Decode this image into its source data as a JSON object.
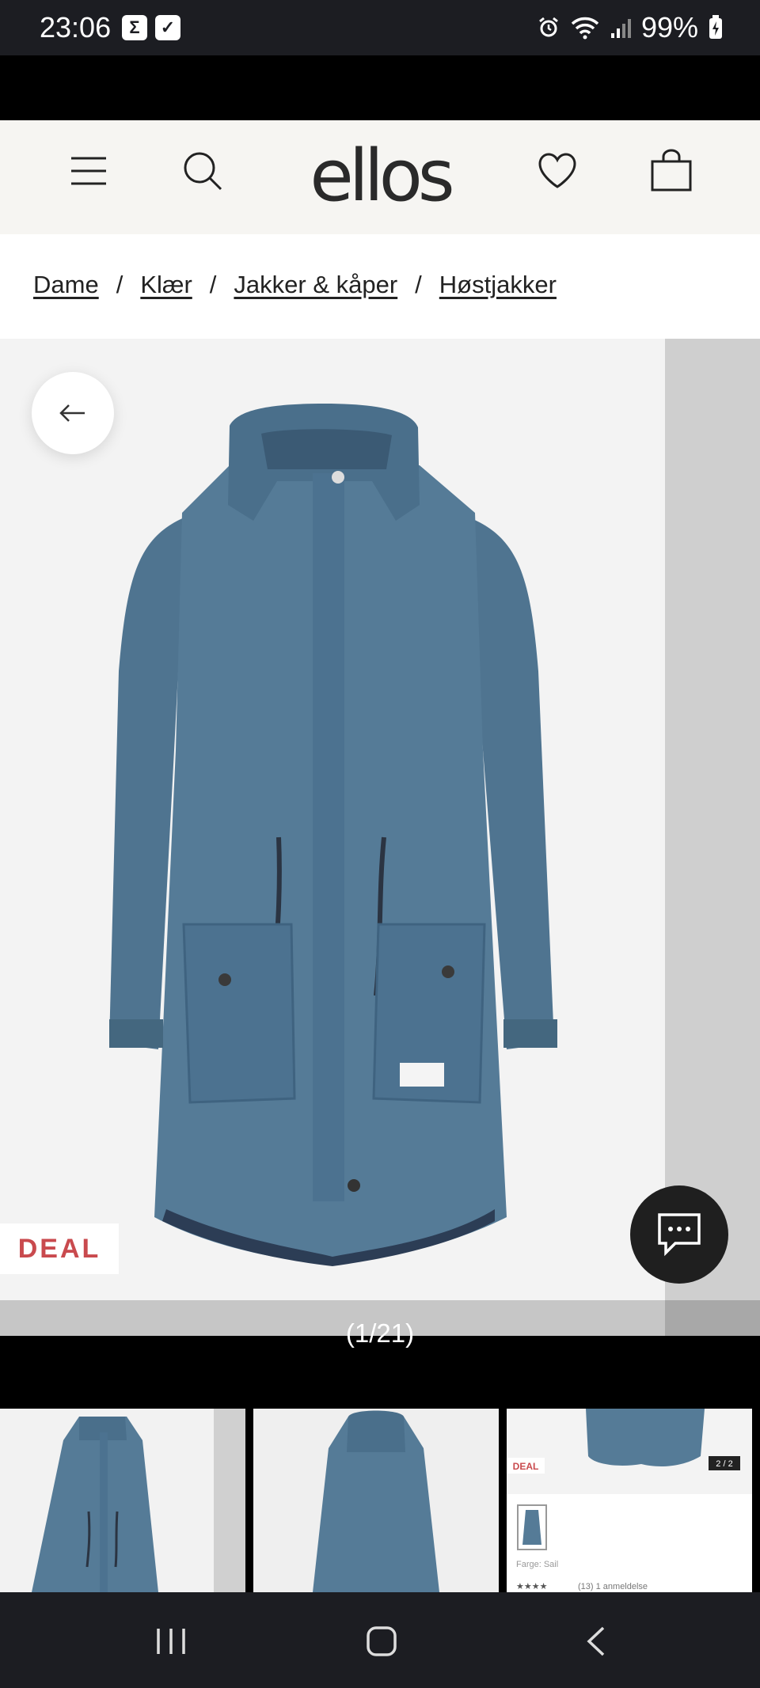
{
  "status_bar": {
    "time": "23:06",
    "badge_1": "Σ",
    "badge_2": "✓",
    "battery": "99%"
  },
  "header": {
    "logo": "ellos",
    "menu_icon": "hamburger-menu-icon",
    "search_icon": "search-icon",
    "wishlist_icon": "heart-icon",
    "cart_icon": "shopping-bag-icon"
  },
  "breadcrumb": [
    "Dame",
    "Klær",
    "Jakker & kåper",
    "Høstjakker"
  ],
  "gallery": {
    "badge": "DEAL",
    "counter": "(1/21)",
    "product_color": "#4f7490",
    "badge_color": "#c94a4e"
  },
  "thumbnails": {
    "third": {
      "deal": "DEAL",
      "pager": "2 / 2",
      "color_label": "Farge: Sail",
      "rating_text": "(13) 1 anmeldelse"
    }
  },
  "navbar": {
    "recent": "recent-apps-icon",
    "home": "home-icon",
    "back": "back-icon"
  }
}
